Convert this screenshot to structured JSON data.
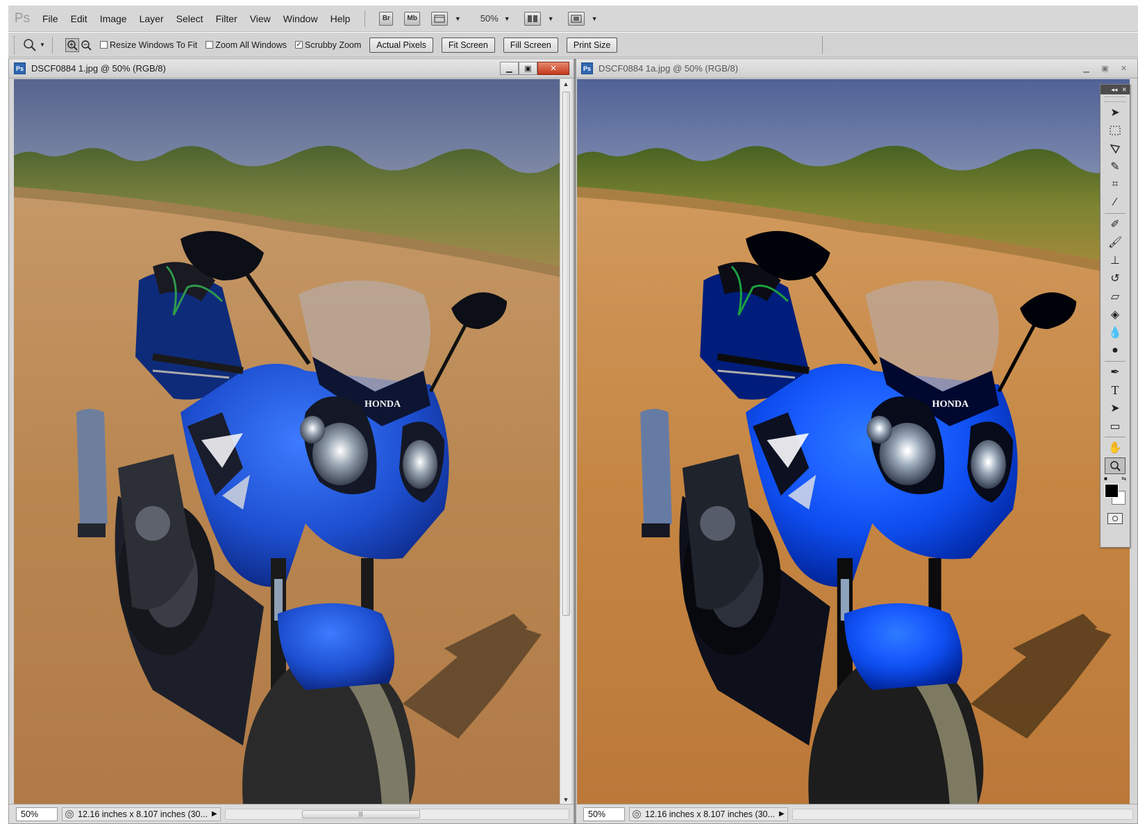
{
  "app": {
    "logo": "Ps"
  },
  "menu": [
    "File",
    "Edit",
    "Image",
    "Layer",
    "Select",
    "Filter",
    "View",
    "Window",
    "Help"
  ],
  "app_bar": {
    "bridge": "Br",
    "minibridge": "Mb",
    "zoom": "50%"
  },
  "options": {
    "resize_windows": "Resize Windows To Fit",
    "zoom_all": "Zoom All Windows",
    "scrubby_zoom": "Scrubby Zoom",
    "scrubby_checked": true,
    "actual_pixels": "Actual Pixels",
    "fit_screen": "Fit Screen",
    "fill_screen": "Fill Screen",
    "print_size": "Print Size"
  },
  "documents": [
    {
      "title": "DSCF0884 1.jpg @ 50% (RGB/8)",
      "zoom": "50%",
      "info": "12.16 inches x 8.107 inches (30..."
    },
    {
      "title": "DSCF0884 1a.jpg @ 50% (RGB/8)",
      "zoom": "50%",
      "info": "12.16 inches x 8.107 inches (30..."
    }
  ],
  "photo": {
    "brand_text": "HONDA"
  },
  "tools": [
    "move-tool",
    "marquee-tool",
    "lasso-tool",
    "quick-selection-tool",
    "crop-tool",
    "eyedropper-tool",
    "healing-brush-tool",
    "brush-tool",
    "clone-stamp-tool",
    "history-brush-tool",
    "eraser-tool",
    "paint-bucket-tool",
    "blur-tool",
    "dodge-tool",
    "pen-tool",
    "type-tool",
    "path-selection-tool",
    "rectangle-tool",
    "hand-tool",
    "zoom-tool"
  ],
  "colors": {
    "foreground": "#000000",
    "background": "#ffffff",
    "bike_blue": "#1d4fd0",
    "sky": "#5a6a92",
    "dirt": "#b8834d"
  }
}
